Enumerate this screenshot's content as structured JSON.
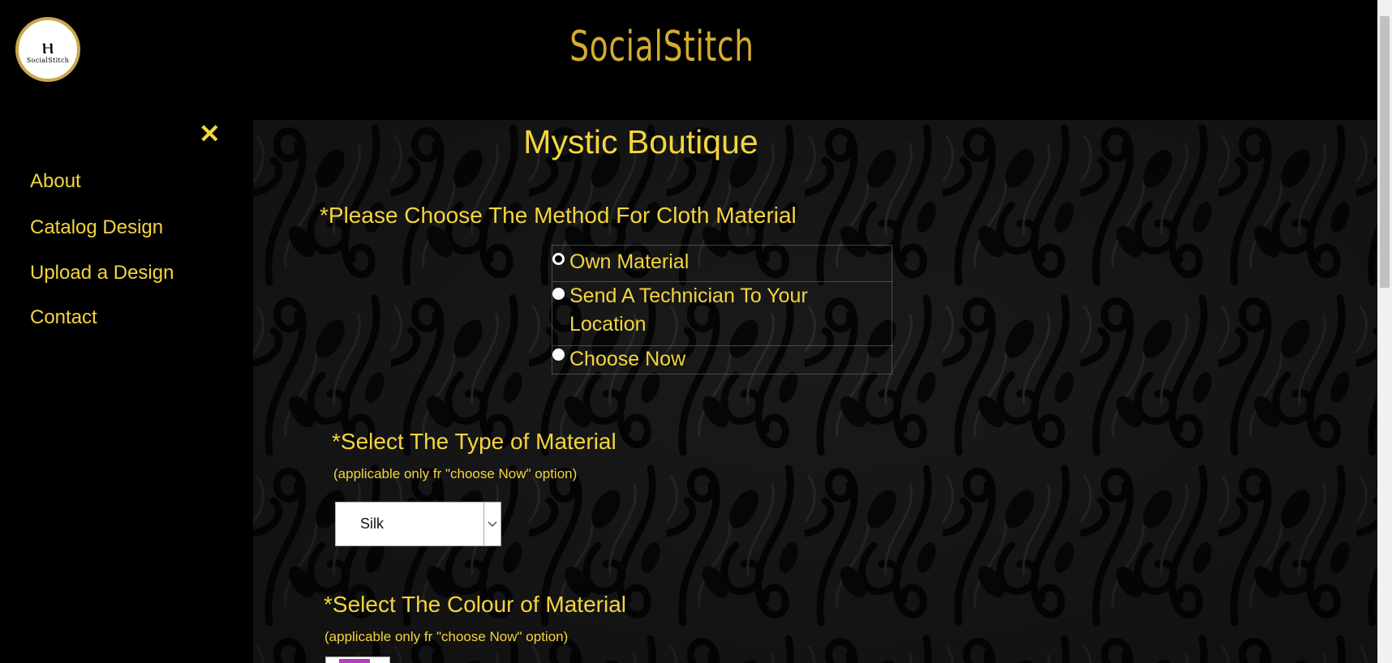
{
  "header": {
    "logo_mark": "ⲏ",
    "logo_text": "SocialStitch",
    "brand": "SocialStitch"
  },
  "sidebar": {
    "close_glyph": "✕",
    "items": [
      {
        "label": "About"
      },
      {
        "label": "Catalog Design"
      },
      {
        "label": "Upload a Design"
      },
      {
        "label": "Contact"
      }
    ]
  },
  "main": {
    "title": "Mystic Boutique",
    "method": {
      "question": "*Please Choose The Method For Cloth Material",
      "options": [
        {
          "label": "Own Material",
          "checked": true
        },
        {
          "label": "Send A Technician To Your Location",
          "checked": false
        },
        {
          "label": "Choose Now",
          "checked": false
        }
      ]
    },
    "material_type": {
      "question": "*Select The Type of Material",
      "note": "(applicable only fr \"choose Now\" option)",
      "selected": "Silk"
    },
    "material_colour": {
      "question": "*Select The Colour of Material",
      "note": "(applicable only fr \"choose Now\" option)",
      "swatch_color": "#b43fb9"
    }
  },
  "colors": {
    "accent": "#f4d53e",
    "brand_gold": "#d4ad2f",
    "background": "#000000"
  },
  "icons": {
    "close": "close-icon",
    "select_arrow": "chevron-down-icon",
    "logo": "logo-icon"
  }
}
